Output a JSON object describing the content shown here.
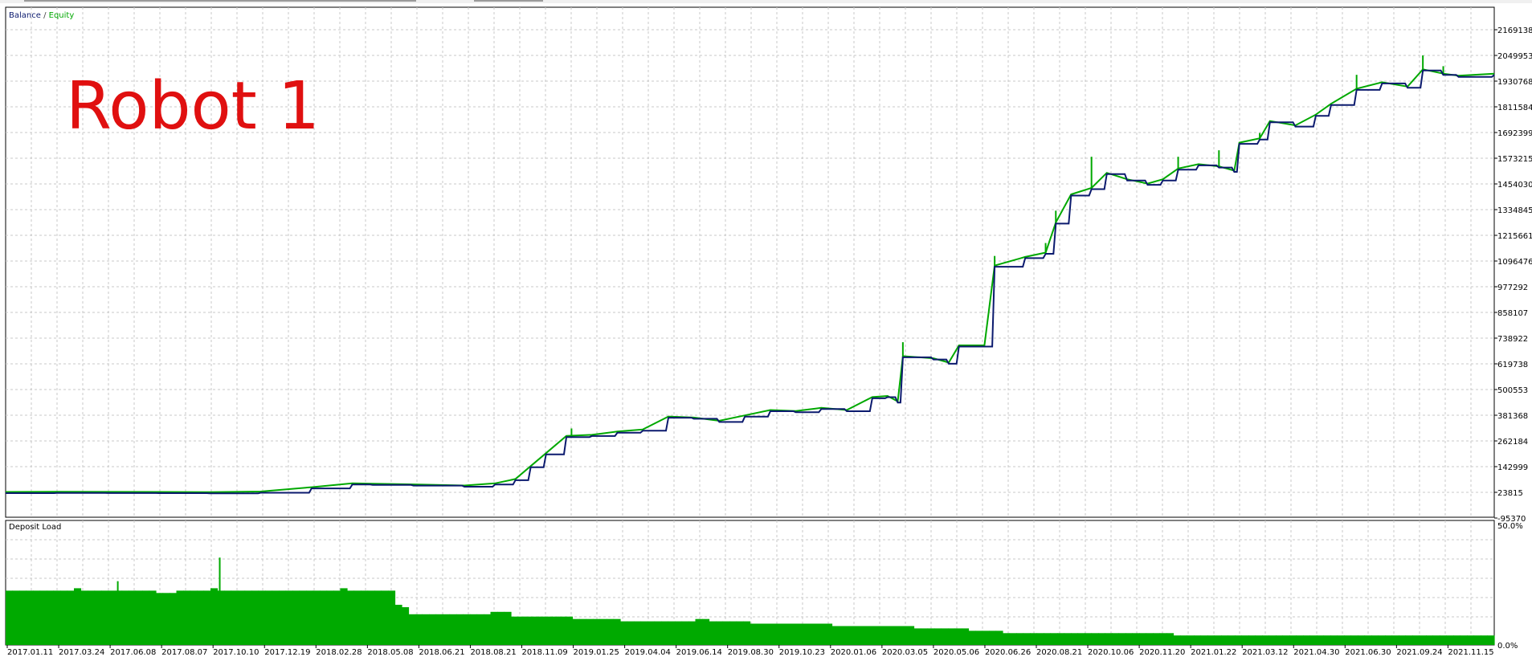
{
  "overlay_text": "Robot 1",
  "colors": {
    "balance": "#0b1a6e",
    "equity": "#00a800",
    "deposit_load": "#00aa00",
    "grid": "#c8c8c8",
    "overlay": "#e01010",
    "frame": "#000000"
  },
  "chart_data": [
    {
      "type": "line",
      "title": "",
      "legend": [
        "Balance",
        "Equity"
      ],
      "legend_separator": " / ",
      "legend_placement": "top-left",
      "grid": true,
      "ylim": [
        -95370,
        2169138
      ],
      "y_ticks": [
        "2169138",
        "2049953",
        "1930768",
        "1811584",
        "1692399",
        "1573215",
        "1454030",
        "1334845",
        "1215661",
        "1096476",
        "977292",
        "858107",
        "738922",
        "619738",
        "500553",
        "381368",
        "262184",
        "142999",
        "23815",
        "-95370"
      ],
      "x_ticks": [
        "2017.01.11",
        "2017.03.24",
        "2017.06.08",
        "2017.08.07",
        "2017.10.10",
        "2017.12.19",
        "2018.02.28",
        "2018.05.08",
        "2018.06.21",
        "2018.08.21",
        "2018.11.09",
        "2019.01.25",
        "2019.04.04",
        "2019.06.14",
        "2019.08.30",
        "2019.10.23",
        "2020.01.06",
        "2020.03.05",
        "2020.05.06",
        "2020.06.26",
        "2020.08.21",
        "2020.10.06",
        "2020.11.20",
        "2021.01.22",
        "2021.03.12",
        "2021.04.30",
        "2021.06.30",
        "2021.09.24",
        "2021.11.15"
      ],
      "x_range": [
        0,
        29.2
      ],
      "series": [
        {
          "name": "Balance",
          "points": [
            [
              0,
              20000
            ],
            [
              1,
              21000
            ],
            [
              2,
              20500
            ],
            [
              3,
              20000
            ],
            [
              4,
              19000
            ],
            [
              5,
              22000
            ],
            [
              6,
              42000
            ],
            [
              6.8,
              60000
            ],
            [
              7.2,
              58000
            ],
            [
              8,
              55000
            ],
            [
              9,
              50000
            ],
            [
              9.6,
              60000
            ],
            [
              10,
              80000
            ],
            [
              10.3,
              140000
            ],
            [
              10.6,
              200000
            ],
            [
              11,
              280000
            ],
            [
              11.5,
              285000
            ],
            [
              12,
              300000
            ],
            [
              12.5,
              310000
            ],
            [
              13,
              370000
            ],
            [
              13.5,
              365000
            ],
            [
              14,
              350000
            ],
            [
              14.5,
              375000
            ],
            [
              15,
              400000
            ],
            [
              15.5,
              395000
            ],
            [
              16,
              410000
            ],
            [
              16.5,
              400000
            ],
            [
              17,
              460000
            ],
            [
              17.3,
              465000
            ],
            [
              17.5,
              440000
            ],
            [
              17.6,
              650000
            ],
            [
              18.2,
              640000
            ],
            [
              18.5,
              620000
            ],
            [
              18.7,
              700000
            ],
            [
              19.2,
              700000
            ],
            [
              19.4,
              1070000
            ],
            [
              20.0,
              1110000
            ],
            [
              20.4,
              1130000
            ],
            [
              20.6,
              1270000
            ],
            [
              20.9,
              1400000
            ],
            [
              21.3,
              1430000
            ],
            [
              21.6,
              1500000
            ],
            [
              22.0,
              1470000
            ],
            [
              22.4,
              1450000
            ],
            [
              22.7,
              1470000
            ],
            [
              23.0,
              1520000
            ],
            [
              23.4,
              1540000
            ],
            [
              23.8,
              1530000
            ],
            [
              24.1,
              1510000
            ],
            [
              24.2,
              1640000
            ],
            [
              24.6,
              1660000
            ],
            [
              24.8,
              1740000
            ],
            [
              25.3,
              1720000
            ],
            [
              25.7,
              1770000
            ],
            [
              26.0,
              1820000
            ],
            [
              26.5,
              1890000
            ],
            [
              27.0,
              1920000
            ],
            [
              27.5,
              1900000
            ],
            [
              27.8,
              1980000
            ],
            [
              28.2,
              1960000
            ],
            [
              28.5,
              1950000
            ],
            [
              29.2,
              1960000
            ]
          ]
        },
        {
          "name": "Equity",
          "spikes": [
            [
              6.8,
              64000
            ],
            [
              11.1,
              320000
            ],
            [
              17.6,
              720000
            ],
            [
              19.4,
              1120000
            ],
            [
              20.4,
              1180000
            ],
            [
              20.6,
              1330000
            ],
            [
              21.3,
              1580000
            ],
            [
              23.0,
              1580000
            ],
            [
              23.8,
              1610000
            ],
            [
              24.6,
              1690000
            ],
            [
              26.5,
              1960000
            ],
            [
              27.8,
              2050000
            ],
            [
              28.2,
              2000000
            ]
          ]
        }
      ]
    },
    {
      "type": "area",
      "title": "Deposit Load",
      "ylim": [
        0,
        50
      ],
      "y_ticks": [
        "50.0%",
        "0.0%"
      ],
      "series": [
        {
          "name": "Deposit Load",
          "x_range": [
            0,
            29.2
          ],
          "values": [
            23,
            23,
            23,
            23,
            23,
            23,
            23,
            23,
            23,
            23,
            24,
            23,
            23,
            23,
            23,
            23,
            23,
            23,
            23,
            23,
            23,
            23,
            22,
            22,
            22,
            23,
            23,
            23,
            23,
            23,
            24,
            23,
            23,
            23,
            23,
            23,
            23,
            23,
            23,
            23,
            23,
            23,
            23,
            23,
            23,
            23,
            23,
            23,
            23,
            24,
            23,
            23,
            23,
            23,
            23,
            23,
            23,
            17,
            16,
            13,
            13,
            13,
            13,
            13,
            13,
            13,
            13,
            13,
            13,
            13,
            13,
            14,
            14,
            14,
            12,
            12,
            12,
            12,
            12,
            12,
            12,
            12,
            12,
            11,
            11,
            11,
            11,
            11,
            11,
            11,
            10,
            10,
            10,
            10,
            10,
            10,
            10,
            10,
            10,
            10,
            10,
            11,
            11,
            10,
            10,
            10,
            10,
            10,
            10,
            9,
            9,
            9,
            9,
            9,
            9,
            9,
            9,
            9,
            9,
            9,
            9,
            8,
            8,
            8,
            8,
            8,
            8,
            8,
            8,
            8,
            8,
            8,
            8,
            7,
            7,
            7,
            7,
            7,
            7,
            7,
            7,
            6,
            6,
            6,
            6,
            6,
            5,
            5,
            5,
            5,
            5,
            5,
            5,
            5,
            5,
            5,
            5,
            5,
            5,
            5,
            5,
            5,
            5,
            5,
            5,
            5,
            5,
            5,
            5,
            5,
            5,
            4,
            4,
            4,
            4,
            4,
            4,
            4,
            4,
            4,
            4,
            4,
            4,
            4,
            4,
            4,
            4,
            4,
            4,
            4,
            4,
            4,
            4,
            4,
            4,
            4,
            4,
            4,
            4,
            4,
            4,
            4,
            4,
            4,
            4,
            4,
            4,
            4,
            4,
            4,
            4,
            4,
            4,
            4,
            4,
            4,
            4,
            4
          ],
          "spikes": [
            [
              2.2,
              27
            ],
            [
              4.2,
              37
            ]
          ]
        }
      ]
    }
  ]
}
